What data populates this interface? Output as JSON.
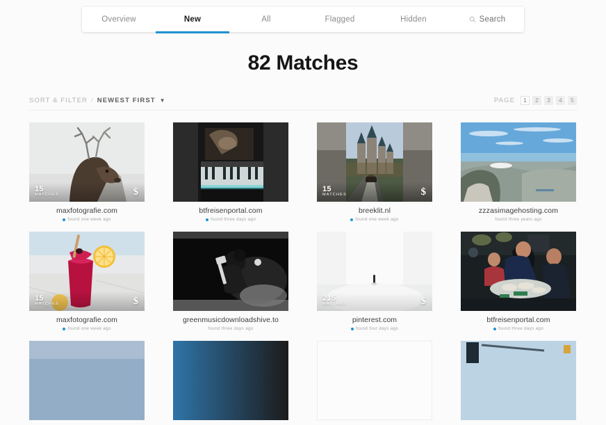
{
  "nav": {
    "tabs": [
      {
        "label": "Overview",
        "active": false
      },
      {
        "label": "New",
        "active": true
      },
      {
        "label": "All",
        "active": false
      },
      {
        "label": "Flagged",
        "active": false
      },
      {
        "label": "Hidden",
        "active": false
      }
    ],
    "search_label": "Search",
    "search_icon": "search-icon",
    "active_underline_color": "#1f93d1"
  },
  "headline": "82 Matches",
  "toolbar": {
    "sort_label": "SORT & FILTER",
    "separator": "/",
    "sort_value": "NEWEST FIRST",
    "caret": "▼",
    "page_label": "PAGE",
    "pages": [
      "1",
      "2",
      "3",
      "4",
      "5"
    ],
    "active_page": "1"
  },
  "grid": {
    "cards": [
      {
        "domain": "maxfotografie.com",
        "found": "found one week ago",
        "found_new": true,
        "matches_count": "15",
        "matches_label": "MATCHES",
        "has_dollar": true,
        "image": "deer-stag-photo"
      },
      {
        "domain": "btfreisenportal.com",
        "found": "found three days ago",
        "found_new": true,
        "matches_count": "",
        "matches_label": "",
        "has_dollar": false,
        "image": "piano-keys-dark-photo"
      },
      {
        "domain": "breeklit.nl",
        "found": "found one week ago",
        "found_new": true,
        "matches_count": "15",
        "matches_label": "MATCHES",
        "has_dollar": true,
        "image": "castle-eltz-photo"
      },
      {
        "domain": "zzzasimagehosting.com",
        "found": "found three years ago",
        "found_new": false,
        "matches_count": "",
        "matches_label": "",
        "has_dollar": false,
        "image": "cape-town-aerial-photo"
      },
      {
        "domain": "maxfotografie.com",
        "found": "found one week ago",
        "found_new": true,
        "matches_count": "15",
        "matches_label": "MATCHES",
        "has_dollar": true,
        "image": "berry-smoothie-photo"
      },
      {
        "domain": "greenmusicdownloadshive.to",
        "found": "found three days ago",
        "found_new": false,
        "matches_count": "",
        "matches_label": "",
        "has_dollar": false,
        "image": "guitarist-bw-photo"
      },
      {
        "domain": "pinterest.com",
        "found": "found four days ago",
        "found_new": true,
        "matches_count": "215",
        "matches_label": "MATCHES",
        "has_dollar": true,
        "image": "minimal-snow-figure-photo"
      },
      {
        "domain": "btfreisenportal.com",
        "found": "found three days ago",
        "found_new": true,
        "matches_count": "",
        "matches_label": "",
        "has_dollar": false,
        "image": "street-market-vendors-photo"
      },
      {
        "domain": "",
        "found": "",
        "found_new": false,
        "matches_count": "",
        "matches_label": "",
        "has_dollar": false,
        "image": "coastal-sky-photo"
      },
      {
        "domain": "",
        "found": "",
        "found_new": false,
        "matches_count": "",
        "matches_label": "",
        "has_dollar": false,
        "image": "blue-dark-gradient-photo"
      },
      {
        "domain": "",
        "found": "",
        "found_new": false,
        "matches_count": "",
        "matches_label": "",
        "has_dollar": false,
        "image": "white-blank-photo"
      },
      {
        "domain": "",
        "found": "",
        "found_new": false,
        "matches_count": "",
        "matches_label": "",
        "has_dollar": false,
        "image": "city-crane-photo"
      }
    ]
  }
}
